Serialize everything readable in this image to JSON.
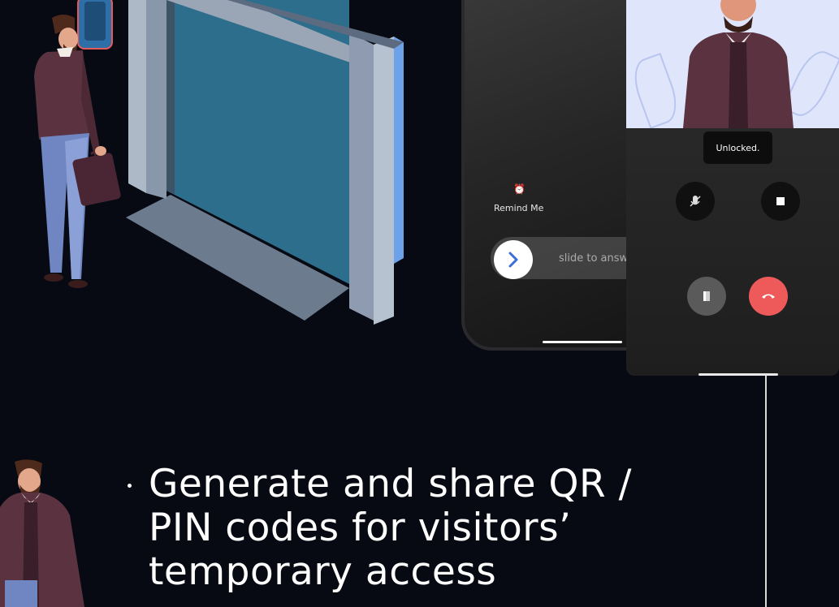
{
  "incoming_call": {
    "remind_me_label": "Remind Me",
    "slide_label": "slide to answ"
  },
  "call_screen": {
    "status_toast": "Unlocked."
  },
  "feature": {
    "line1": "Generate and share QR /",
    "line2": "PIN codes for visitors’",
    "line3": "temporary access"
  },
  "colors": {
    "background": "#070a12",
    "glass": "#2c6e8c",
    "frame": "#7f8fa6",
    "hangup": "#ee5a5a",
    "accent_arrow": "#3b6fd8"
  },
  "icons": [
    "alarm-clock-icon",
    "chevron-right-icon",
    "mute-mic-icon",
    "stop-icon",
    "door-icon",
    "hang-up-icon"
  ]
}
